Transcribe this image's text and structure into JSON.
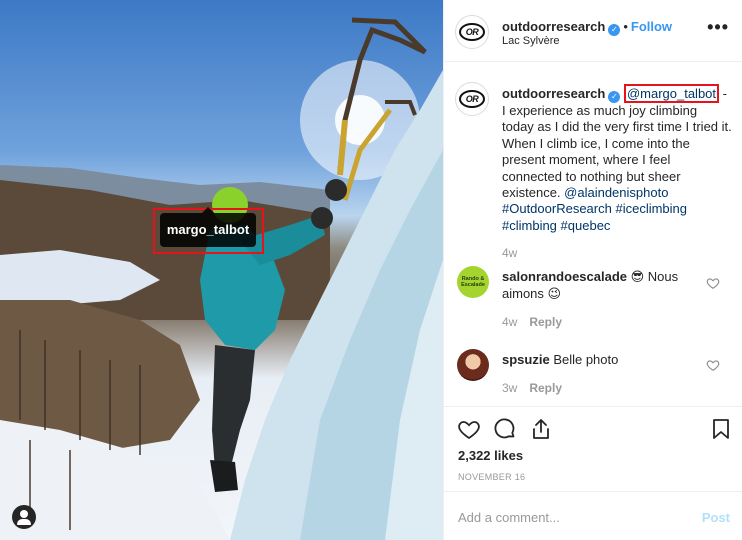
{
  "photo": {
    "tag_label": "margo_talbot",
    "tags_icon": "user-tag-icon"
  },
  "header": {
    "username": "outdoorresearch",
    "separator": "•",
    "follow_label": "Follow",
    "location": "Lac Sylvère",
    "more_icon": "more-options-icon",
    "more_label": "•••"
  },
  "caption": {
    "username": "outdoorresearch",
    "mention": "@margo_talbot",
    "text_before": " - I experience as much joy climbing today as I did the very first time I tried it. When I climb ice, I come into the present moment, where I feel connected to nothing but sheer existence. ",
    "mention_photo": "@alaindenisphoto",
    "hashtags": [
      "#OutdoorResearch",
      "#iceclimbing",
      "#climbing",
      "#quebec"
    ],
    "time": "4w"
  },
  "comments": [
    {
      "username": "salonrandoescalade",
      "text": "😎 Nous aimons 😉",
      "time": "4w",
      "reply_label": "Reply",
      "avatar_text": "Rando & Escalade"
    },
    {
      "username": "spsuzie",
      "text": "Belle photo",
      "time": "3w",
      "reply_label": "Reply"
    }
  ],
  "actions": {
    "icons": [
      "heart-icon",
      "comment-icon",
      "share-icon",
      "bookmark-icon"
    ],
    "likes": "2,322 likes",
    "date": "NOVEMBER 16"
  },
  "add_comment": {
    "placeholder": "Add a comment...",
    "post_label": "Post"
  },
  "colors": {
    "accent": "#3897f0",
    "highlight": "#e3141b",
    "link": "#003569",
    "muted": "#999999"
  }
}
